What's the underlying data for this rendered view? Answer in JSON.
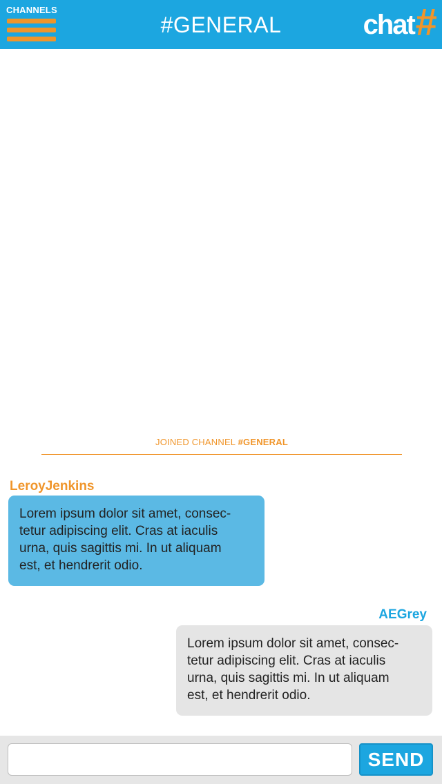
{
  "header": {
    "channels_label": "CHANNELS",
    "menu_icon": "hamburger-menu-icon",
    "title": "#GENERAL",
    "logo_text": "chat",
    "logo_symbol": "#"
  },
  "system_message": {
    "prefix": "JOINED CHANNEL",
    "channel": "#GENERAL"
  },
  "messages": [
    {
      "username": "LeroyJenkins",
      "text": "Lorem ipsum dolor sit amet, consec-tetur adipiscing elit. Cras at iaculis urna, quis sagittis mi. In ut aliquam est, et hendrerit odio.",
      "lines": [
        "Lorem ipsum dolor sit amet, consec-",
        "tetur adipiscing elit. Cras at iaculis",
        "urna, quis sagittis mi. In ut aliquam",
        "est, et hendrerit odio."
      ],
      "direction": "incoming"
    },
    {
      "username": "AEGrey",
      "text": "Lorem ipsum dolor sit amet, consec-tetur adipiscing elit. Cras at iaculis urna, quis sagittis mi. In ut aliquam est, et hendrerit odio.",
      "lines": [
        "Lorem ipsum dolor sit amet, consec-",
        "tetur adipiscing elit. Cras at iaculis",
        "urna, quis sagittis mi. In ut aliquam",
        "est, et hendrerit odio."
      ],
      "direction": "outgoing"
    }
  ],
  "composer": {
    "input_value": "",
    "send_label": "SEND"
  },
  "colors": {
    "header_bg": "#1ca6e0",
    "accent_orange": "#f0952a",
    "incoming_bubble": "#5bb9e4",
    "outgoing_bubble": "#e5e5e5",
    "composer_bg": "#e6e6e6"
  }
}
